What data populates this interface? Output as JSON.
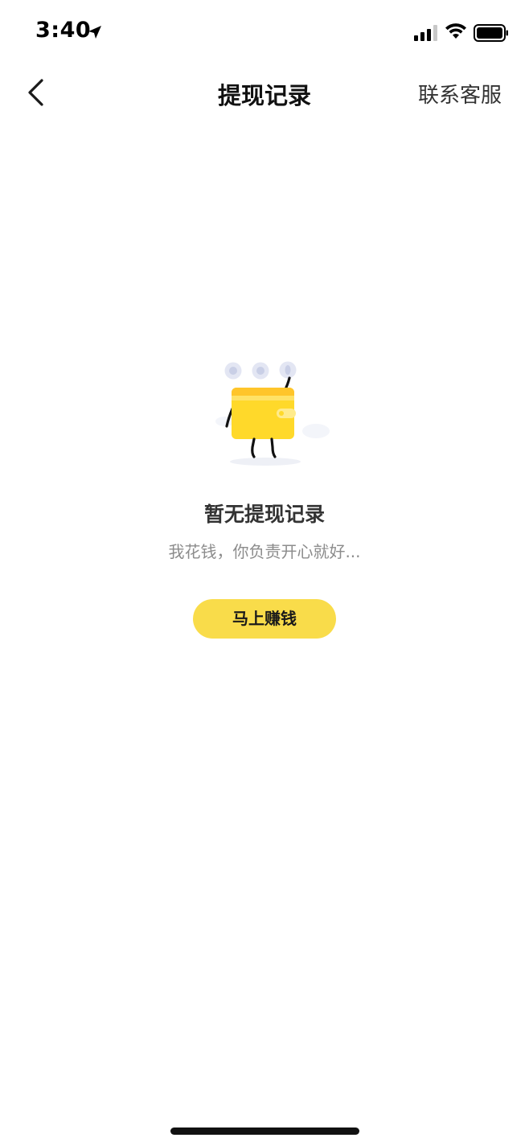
{
  "status_bar": {
    "time": "3:40",
    "icons": [
      "location-arrow-icon",
      "cellular-signal-icon",
      "wifi-icon",
      "battery-icon"
    ]
  },
  "nav": {
    "back_icon": "chevron-left-icon",
    "title": "提现记录",
    "contact": "联系客服"
  },
  "empty_state": {
    "illustration": "wallet-mascot-illustration",
    "title": "暂无提现记录",
    "subtitle": "我花钱，你负责开心就好..."
  },
  "action": {
    "label": "马上赚钱"
  },
  "colors": {
    "accent": "#f9dc4a",
    "wallet": "#ffd92a",
    "title": "#111111",
    "subtitle": "#8c8c8c"
  }
}
